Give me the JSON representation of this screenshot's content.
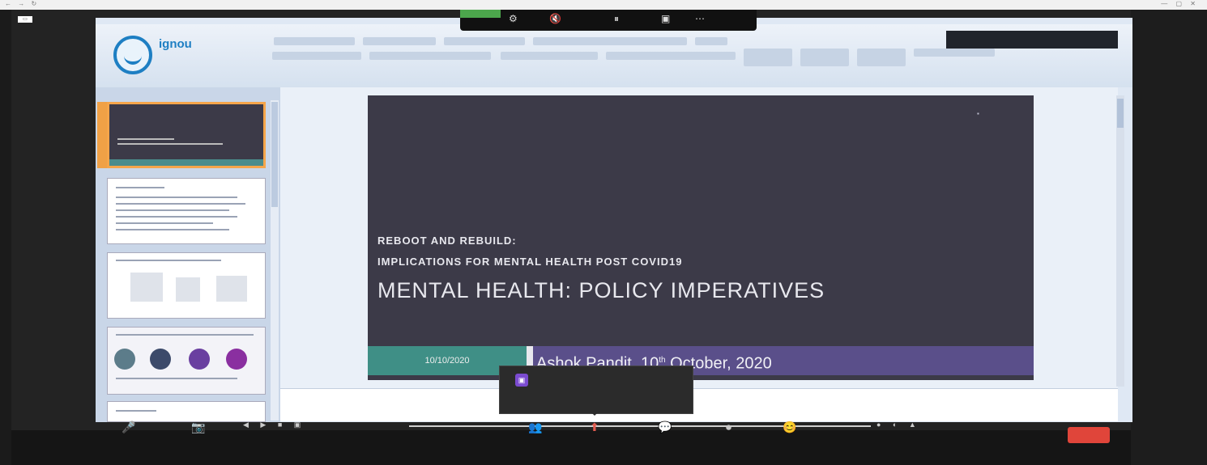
{
  "browser": {
    "url": "",
    "nav_icons": "← → ↻",
    "window_icons": "— ▢ ✕"
  },
  "zoom": {
    "top_left": "▭",
    "share_status": "",
    "share_toolbar_icons": [
      "⚙",
      "🔇",
      "⏸",
      "▣",
      "⋯"
    ],
    "controls": [
      {
        "icon": "🎤",
        "label": ""
      },
      {
        "icon": "📷",
        "label": ""
      },
      {
        "icon": "👥",
        "label": ""
      },
      {
        "icon": "⬆",
        "label": ""
      },
      {
        "icon": "💬",
        "label": ""
      },
      {
        "icon": "⏺",
        "label": ""
      },
      {
        "icon": "😊",
        "label": ""
      }
    ],
    "end_label": "",
    "right_panel_title": ""
  },
  "ppt": {
    "logo_text": "ignou",
    "logo_sub": "",
    "ribbon_tabs": ""
  },
  "slide": {
    "header": "",
    "line1": "REBOOT AND REBUILD:",
    "line2": "IMPLICATIONS FOR MENTAL HEALTH POST COVID19",
    "line3": "MENTAL HEALTH: POLICY IMPERATIVES",
    "date": "10/10/2020",
    "author_prefix": "",
    "author_name": "Ashok Pandit, 10",
    "author_sup": "th",
    "author_date": " October, 2020"
  },
  "notes": {
    "left": "",
    "right": ""
  },
  "notification": {
    "title": "",
    "link": ""
  }
}
